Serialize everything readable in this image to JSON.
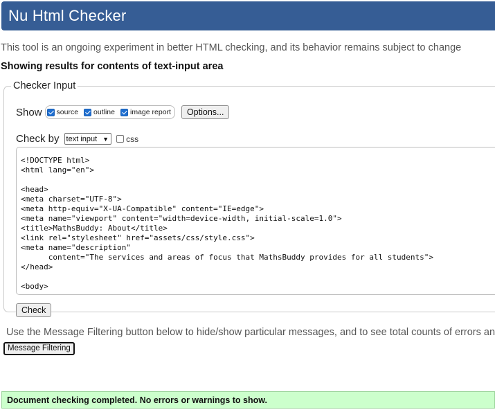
{
  "header": {
    "title": "Nu Html Checker"
  },
  "intro_text": "This tool is an ongoing experiment in better HTML checking, and its behavior remains subject to change",
  "results_heading": "Showing results for contents of text-input area",
  "checker_input": {
    "legend": "Checker Input",
    "show_label": "Show",
    "show_options": [
      {
        "label": "source",
        "checked": true
      },
      {
        "label": "outline",
        "checked": true
      },
      {
        "label": "image report",
        "checked": true
      }
    ],
    "options_button": "Options...",
    "check_by_label": "Check by",
    "check_by_selected": "text input",
    "css_checkbox": {
      "label": "css",
      "checked": false
    },
    "textarea_value": "<!DOCTYPE html>\n<html lang=\"en\">\n\n<head>\n<meta charset=\"UTF-8\">\n<meta http-equiv=\"X-UA-Compatible\" content=\"IE=edge\">\n<meta name=\"viewport\" content=\"width=device-width, initial-scale=1.0\">\n<title>MathsBuddy: About</title>\n<link rel=\"stylesheet\" href=\"assets/css/style.css\">\n<meta name=\"description\"\n      content=\"The services and areas of focus that MathsBuddy provides for all students\">\n</head>\n\n<body>",
    "check_button": "Check"
  },
  "filter": {
    "text": "Use the Message Filtering button below to hide/show particular messages, and to see total counts of errors and",
    "button": "Message Filtering"
  },
  "status_message": "Document checking completed. No errors or warnings to show.",
  "colors": {
    "header_bg": "#365d95",
    "success_bg": "#ccffcc",
    "checkbox_accent": "#1f6fd1"
  }
}
